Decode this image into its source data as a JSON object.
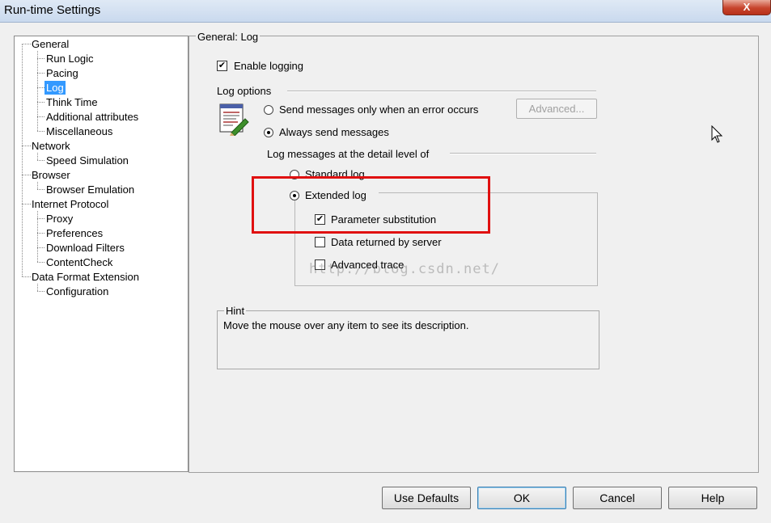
{
  "window": {
    "title": "Run-time Settings",
    "close_glyph": "X"
  },
  "tree": {
    "items": [
      {
        "label": "General",
        "level": 0
      },
      {
        "label": "Run Logic",
        "level": 1
      },
      {
        "label": "Pacing",
        "level": 1
      },
      {
        "label": "Log",
        "level": 1,
        "selected": true
      },
      {
        "label": "Think Time",
        "level": 1
      },
      {
        "label": "Additional attributes",
        "level": 1
      },
      {
        "label": "Miscellaneous",
        "level": 1
      },
      {
        "label": "Network",
        "level": 0
      },
      {
        "label": "Speed Simulation",
        "level": 1
      },
      {
        "label": "Browser",
        "level": 0
      },
      {
        "label": "Browser Emulation",
        "level": 1
      },
      {
        "label": "Internet Protocol",
        "level": 0
      },
      {
        "label": "Proxy",
        "level": 1
      },
      {
        "label": "Preferences",
        "level": 1
      },
      {
        "label": "Download Filters",
        "level": 1
      },
      {
        "label": "ContentCheck",
        "level": 1
      },
      {
        "label": "Data Format Extension",
        "level": 0
      },
      {
        "label": "Configuration",
        "level": 1
      }
    ]
  },
  "panel": {
    "title": "General: Log",
    "enable_logging": {
      "label": "Enable logging",
      "checked": true
    },
    "log_options_label": "Log options",
    "send_on_error": {
      "label": "Send messages only when an error occurs",
      "selected": false
    },
    "always_send": {
      "label": "Always send messages",
      "selected": true
    },
    "advanced_button": "Advanced...",
    "detail_level_label": "Log messages at the detail level of",
    "standard_log": {
      "label": "Standard log",
      "selected": false
    },
    "extended_log": {
      "label": "Extended log",
      "selected": true
    },
    "parameter_substitution": {
      "label": "Parameter substitution",
      "checked": true
    },
    "data_returned": {
      "label": "Data returned by server",
      "checked": false
    },
    "advanced_trace": {
      "label": "Advanced trace",
      "checked": false
    },
    "hint_title": "Hint",
    "hint_text": "Move the mouse over any item to see its description.",
    "watermark": "http://blog.csdn.net/",
    "highlight_color": "#e01010"
  },
  "buttons": {
    "use_defaults": "Use Defaults",
    "ok": "OK",
    "cancel": "Cancel",
    "help": "Help"
  },
  "checkmark_glyph": "✔"
}
